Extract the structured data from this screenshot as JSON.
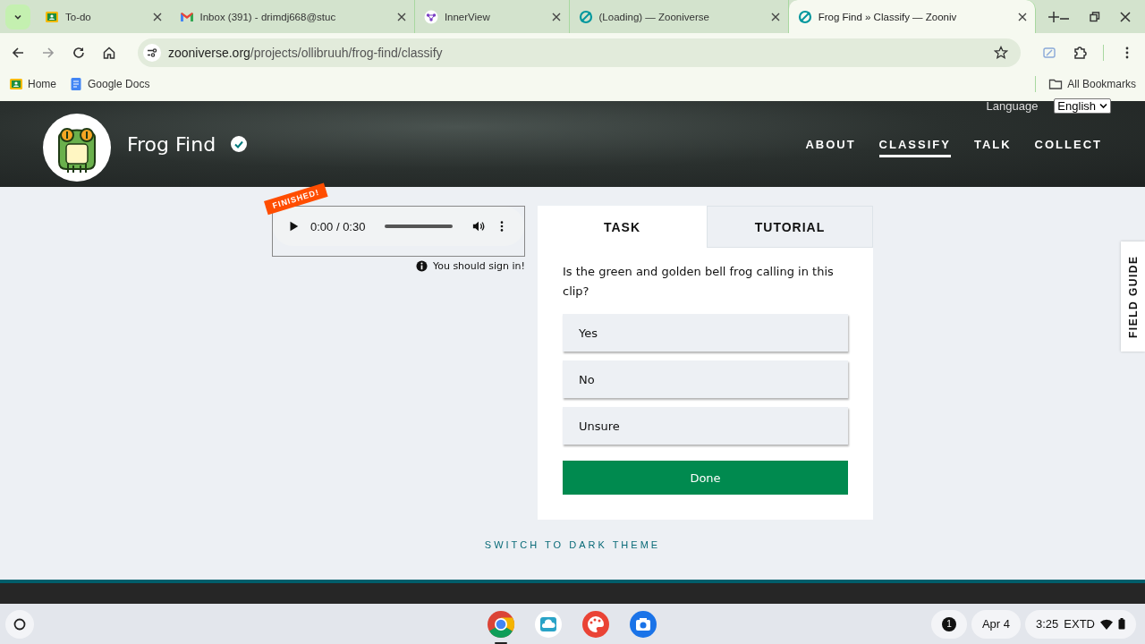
{
  "browser": {
    "tabs": [
      {
        "title": "To-do",
        "selected": false
      },
      {
        "title": "Inbox (391) - drimdj668@stuc",
        "selected": false
      },
      {
        "title": "InnerView",
        "selected": false
      },
      {
        "title": "(Loading) — Zooniverse",
        "selected": false
      },
      {
        "title": "Frog Find » Classify — Zooniv",
        "selected": true
      }
    ],
    "address": {
      "host": "zooniverse.org",
      "path": "/projects/ollibruuh/frog-find/classify"
    },
    "bookmarks": [
      {
        "label": "Home"
      },
      {
        "label": "Google Docs"
      }
    ],
    "all_bookmarks": "All Bookmarks"
  },
  "header": {
    "project": "Frog Find",
    "language_label": "Language",
    "language_value": "English",
    "nav": [
      {
        "label": "ABOUT",
        "selected": false
      },
      {
        "label": "CLASSIFY",
        "selected": true
      },
      {
        "label": "TALK",
        "selected": false
      },
      {
        "label": "COLLECT",
        "selected": false
      }
    ]
  },
  "player": {
    "badge": "FINISHED!",
    "time": "0:00 / 0:30",
    "sign_in_note": "You should sign in!"
  },
  "task_panel": {
    "tabs": [
      {
        "label": "TASK",
        "selected": true
      },
      {
        "label": "TUTORIAL",
        "selected": false
      }
    ],
    "question": "Is the green and golden bell frog calling in this clip?",
    "answers": [
      {
        "label": "Yes",
        "selected": false
      },
      {
        "label": "No",
        "selected": false
      },
      {
        "label": "Unsure",
        "selected": false
      }
    ],
    "done": "Done"
  },
  "field_guide": "FIELD GUIDE",
  "theme_toggle": "SWITCH TO DARK THEME",
  "taskbar": {
    "apps": [
      {
        "kind": "chrome",
        "active": true
      },
      {
        "kind": "files",
        "active": false
      },
      {
        "kind": "paint",
        "active": false
      },
      {
        "kind": "camera",
        "active": false
      }
    ],
    "notifications": "1",
    "date": "Apr 4",
    "time": "3:25",
    "display": "EXTD"
  }
}
